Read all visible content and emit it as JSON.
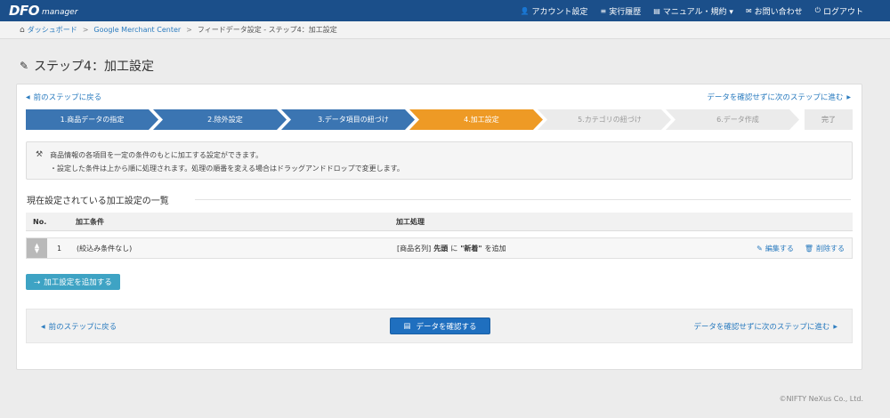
{
  "nav": {
    "logo_main": "DFO",
    "logo_sub": "manager",
    "items": [
      {
        "icon": "user-icon",
        "glyph": "👤",
        "label": "アカウント設定"
      },
      {
        "icon": "list-icon",
        "glyph": "≡",
        "label": "実行履歴"
      },
      {
        "icon": "book-icon",
        "glyph": "▤",
        "label": "マニュアル・規約 ▾"
      },
      {
        "icon": "mail-icon",
        "glyph": "✉",
        "label": "お問い合わせ"
      },
      {
        "icon": "power-icon",
        "glyph": "⏻",
        "label": "ログアウト"
      }
    ]
  },
  "breadcrumb": {
    "items": [
      "ダッシュボード",
      "Google Merchant Center",
      "フィードデータ設定 - ステップ4：加工設定"
    ]
  },
  "page_title": "ステップ4：加工設定",
  "links": {
    "prev_step": "前のステップに戻る",
    "skip_next": "データを確認せずに次のステップに進む"
  },
  "steps": [
    {
      "label": "1.商品データの指定",
      "state": "done"
    },
    {
      "label": "2.除外設定",
      "state": "done"
    },
    {
      "label": "3.データ項目の紐づけ",
      "state": "done"
    },
    {
      "label": "4.加工設定",
      "state": "active"
    },
    {
      "label": "5.カテゴリの紐づけ",
      "state": "todo"
    },
    {
      "label": "6.データ作成",
      "state": "todo"
    },
    {
      "label": "完了",
      "state": "todo"
    }
  ],
  "info": {
    "line1": "商品情報の各項目を一定の条件のもとに加工する設定ができます。",
    "line2": "・設定した条件は上から順に処理されます。処理の順番を変える場合はドラッグアンドドロップで変更します。"
  },
  "section_title": "現在設定されている加工設定の一覧",
  "table": {
    "headers": {
      "no": "No.",
      "condition": "加工条件",
      "process": "加工処理"
    },
    "rows": [
      {
        "no": "1",
        "condition": "(絞込み条件なし)",
        "process_field": "[商品名列]",
        "process_pos": "先頭",
        "process_mid": "に",
        "process_value": "\"新着\"",
        "process_tail": "を追加",
        "edit": "編集する",
        "delete": "削除する"
      }
    ]
  },
  "add_button": "加工設定を追加する",
  "bottom": {
    "prev": "前のステップに戻る",
    "confirm": "データを確認する",
    "next": "データを確認せずに次のステップに進む"
  },
  "footer": "©NIFTY NeXus Co., Ltd.",
  "colors": {
    "nav_bg": "#1b4f8a",
    "step_done": "#3b75b2",
    "step_active": "#ee9a25",
    "step_todo": "#ebebeb",
    "link": "#2a7bbf",
    "add_button": "#3ea3c4",
    "confirm_button": "#1f6fbf"
  }
}
